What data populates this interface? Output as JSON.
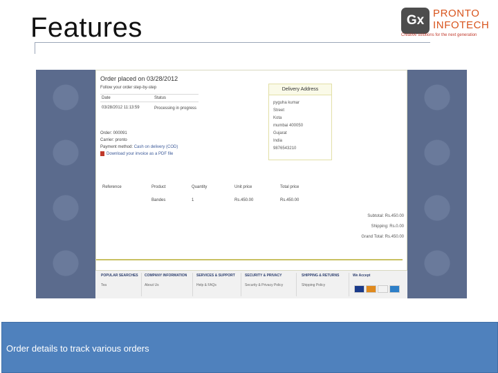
{
  "slide": {
    "title": "Features",
    "caption": "Order details to track various orders"
  },
  "logo": {
    "mark": "Gx",
    "name_line1": "PRONTO",
    "name_line2": "INFOTECH",
    "tagline": "Creative solutions for the next generation"
  },
  "order": {
    "title": "Order placed on 03/28/2012",
    "subtitle": "Follow your order step-by-step",
    "history_headers": [
      "Date",
      "Status"
    ],
    "history_row": {
      "date": "03/28/2012 11:13:59",
      "status": "Processing in progress"
    },
    "order_no": "Order: 000091",
    "carrier": "Carrier: pronto",
    "payment_label": "Payment method:",
    "payment_value": "Cash on delivery (COD)",
    "invoice_link": "Download your invoice as a PDF file"
  },
  "delivery": {
    "header": "Delivery Address",
    "lines": [
      "pyguha kumar",
      "Street",
      "Kota",
      "mumbai 400050",
      "Gujarat",
      "India",
      "9876543210"
    ]
  },
  "products": {
    "headers": [
      "Reference",
      "Product",
      "Quantity",
      "Unit price",
      "Total price"
    ],
    "rows": [
      {
        "reference": "",
        "product": "Bandes",
        "quantity": "1",
        "unit_price": "Rs.450.00",
        "total_price": "Rs.450.00"
      }
    ]
  },
  "totals": [
    "Subtotal: Rs.450.00",
    "Shipping: Rs.0.00",
    "Grand Total: Rs.450.00"
  ],
  "footer": {
    "columns": [
      {
        "title": "POPULAR SEARCHES",
        "item": "Tea"
      },
      {
        "title": "COMPANY INFORMATION",
        "item": "About Us"
      },
      {
        "title": "SERVICES & SUPPORT",
        "item": "Help & FAQs"
      },
      {
        "title": "SECURITY & PRIVACY",
        "item": "Security & Privacy Policy"
      },
      {
        "title": "SHIPPING & RETURNS",
        "item": "Shipping Policy"
      },
      {
        "title": "We Accept",
        "item": ""
      }
    ]
  },
  "colors": {
    "caption_bar": "#4f81bd",
    "logo_accent": "#d8541c",
    "screenshot_bg": "#5a6a8c"
  }
}
